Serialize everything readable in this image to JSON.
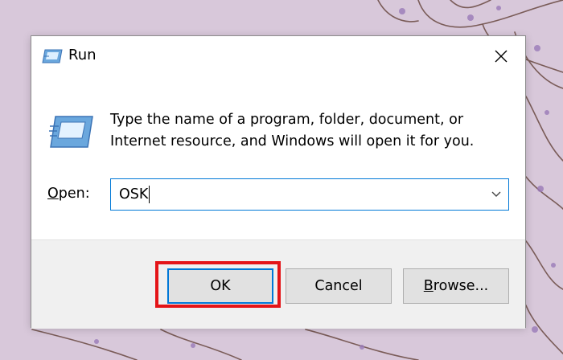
{
  "window": {
    "title": "Run",
    "close_icon": "close-icon"
  },
  "body": {
    "icon": "run-icon",
    "description": "Type the name of a program, folder, document, or Internet resource, and Windows will open it for you."
  },
  "open": {
    "label_accel": "O",
    "label_rest": "pen:",
    "value": "OSK",
    "dropdown_icon": "chevron-down-icon"
  },
  "buttons": {
    "ok": "OK",
    "cancel": "Cancel",
    "browse_accel": "B",
    "browse_rest": "rowse..."
  },
  "colors": {
    "focus_border": "#0078d7",
    "highlight": "#e41418",
    "button_face": "#e1e1e1",
    "footer": "#f0f0f0"
  }
}
